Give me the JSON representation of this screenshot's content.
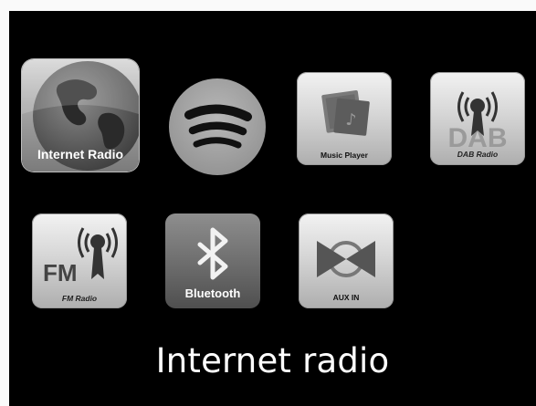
{
  "menu": {
    "items": [
      {
        "id": "internet-radio",
        "label": "Internet Radio",
        "icon": "globe-icon",
        "selected": true
      },
      {
        "id": "spotify",
        "label": "",
        "icon": "spotify-logo-icon",
        "selected": false
      },
      {
        "id": "music-player",
        "label": "Music Player",
        "icon": "music-player-icon",
        "selected": false
      },
      {
        "id": "dab-radio",
        "label": "DAB Radio",
        "icon": "dab-broadcast-icon",
        "selected": false
      },
      {
        "id": "fm-radio",
        "label": "FM Radio",
        "icon": "fm-broadcast-icon",
        "selected": false
      },
      {
        "id": "bluetooth",
        "label": "Bluetooth",
        "icon": "bluetooth-icon",
        "selected": false
      },
      {
        "id": "aux-in",
        "label": "AUX IN",
        "icon": "aux-in-icon",
        "selected": false
      }
    ]
  },
  "caption": "Internet radio",
  "badges": {
    "fm": "FM",
    "dab": "DAB"
  },
  "colors": {
    "background": "#000000",
    "caption": "#ffffff",
    "page_border": "#fafafa"
  }
}
